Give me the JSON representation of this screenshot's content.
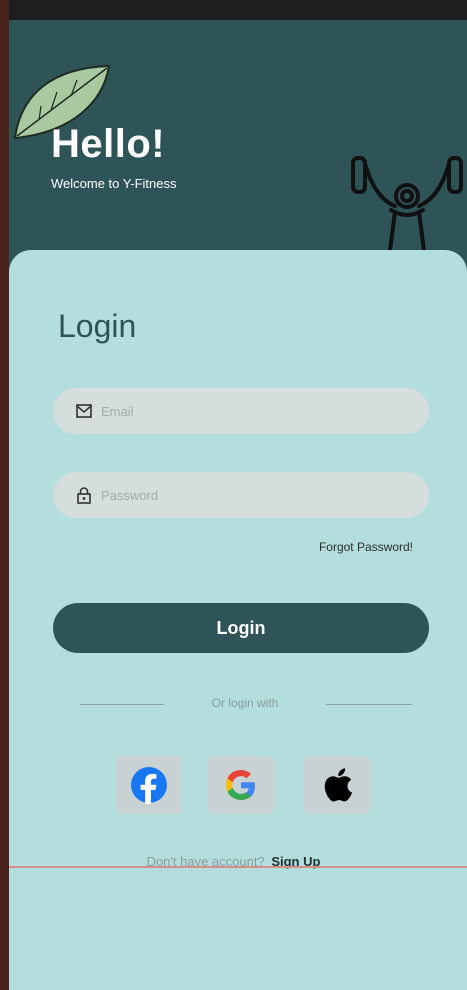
{
  "header": {
    "greeting": "Hello!",
    "subtitle": "Welcome to Y-Fitness"
  },
  "login": {
    "title": "Login",
    "email_placeholder": "Email",
    "password_placeholder": "Password",
    "forgot_label": "Forgot Password!",
    "button_label": "Login",
    "divider_text": "Or login with"
  },
  "social": {
    "items": [
      {
        "name": "facebook",
        "icon": "facebook-icon",
        "color": "#1877f2"
      },
      {
        "name": "google",
        "icon": "google-icon"
      },
      {
        "name": "apple",
        "icon": "apple-icon",
        "color": "#000000"
      }
    ]
  },
  "signup": {
    "prompt": "Don't have account?",
    "link_label": "Sign Up"
  },
  "colors": {
    "primary": "#2e5457",
    "background": "#b4dede",
    "field": "#d6dddd",
    "leaf": "#a9c9a0"
  }
}
